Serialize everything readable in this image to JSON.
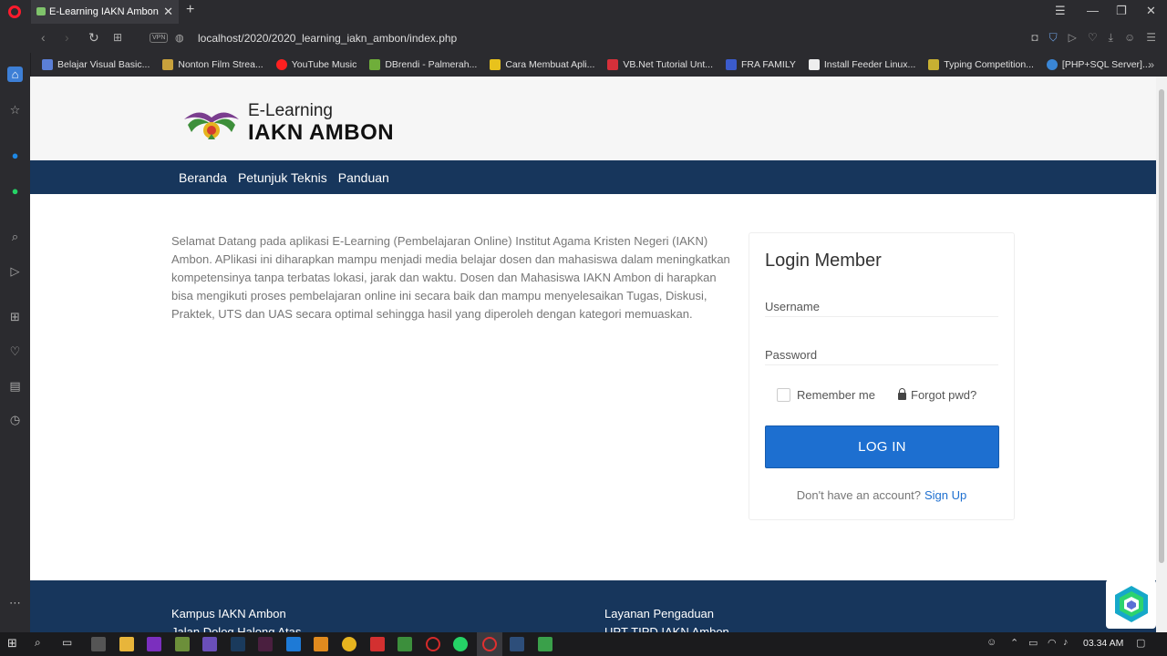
{
  "browser": {
    "tab_title": "E-Learning IAKN Ambon",
    "tab_close": "✕",
    "new_tab": "+",
    "url": "localhost/2020/2020_learning_iakn_ambon/index.php",
    "vpn_label": "VPN",
    "bookmarks": [
      {
        "label": "Belajar Visual Basic...",
        "color": "#5b7fd6"
      },
      {
        "label": "Nonton Film Strea...",
        "color": "#c8a13c"
      },
      {
        "label": "YouTube Music",
        "color": "#ff2020"
      },
      {
        "label": "DBrendi - Palmerah...",
        "color": "#6fae3a"
      },
      {
        "label": "Cara Membuat Apli...",
        "color": "#e8c21c"
      },
      {
        "label": "VB.Net Tutorial Unt...",
        "color": "#d6303a"
      },
      {
        "label": "FRA FAMILY",
        "color": "#3b5bcc"
      },
      {
        "label": "Install Feeder Linux...",
        "color": "#eeeeee"
      },
      {
        "label": "Typing Competition...",
        "color": "#c8b032"
      },
      {
        "label": "[PHP+SQL Server]...",
        "color": "#3a86d6"
      }
    ],
    "bookmarks_more": "»"
  },
  "site": {
    "logo_sub": "E-Learning",
    "logo_main": "IAKN AMBON",
    "nav": [
      "Beranda",
      "Petunjuk Teknis",
      "Panduan"
    ],
    "intro": "Selamat Datang pada aplikasi E-Learning (Pembelajaran Online) Institut Agama Kristen Negeri (IAKN) Ambon. APlikasi ini diharapkan mampu menjadi media belajar dosen dan mahasiswa dalam meningkatkan kompetensinya tanpa terbatas lokasi, jarak dan waktu. Dosen dan Mahasiswa IAKN Ambon di harapkan bisa mengikuti proses pembelajaran online ini secara baik dan mampu menyelesaikan Tugas, Diskusi, Praktek, UTS dan UAS secara optimal sehingga hasil yang diperoleh dengan kategori memuaskan.",
    "login": {
      "title": "Login Member",
      "username_placeholder": "Username",
      "password_placeholder": "Password",
      "remember": "Remember me",
      "forgot": "Forgot pwd?",
      "button": "LOG IN",
      "no_account": "Don't have an account?",
      "signup": "Sign Up"
    },
    "footer": {
      "col1_title": "Kampus IAKN Ambon",
      "col1_line": "Jalan Dolog Halong Atas",
      "col2_title": "Layanan Pengaduan",
      "col2_line": "UPT TIPD IAKN Ambon"
    }
  },
  "taskbar": {
    "clock": "03.34 AM"
  },
  "colors": {
    "navy": "#17365c",
    "button_blue": "#1d6fd0"
  }
}
